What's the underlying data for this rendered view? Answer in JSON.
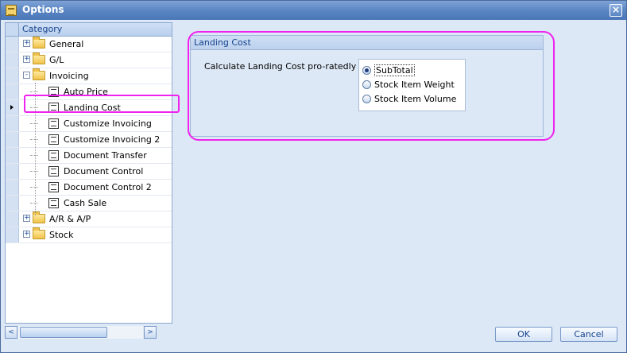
{
  "window": {
    "title": "Options",
    "close_glyph": "×",
    "icon": "options-app-icon"
  },
  "tree": {
    "header": "Category",
    "items": [
      {
        "label": "General",
        "level": 0,
        "type": "folder",
        "expander": "+"
      },
      {
        "label": "G/L",
        "level": 0,
        "type": "folder",
        "expander": "+"
      },
      {
        "label": "Invoicing",
        "level": 0,
        "type": "folder",
        "expander": "-"
      },
      {
        "label": "Auto Price",
        "level": 1,
        "type": "page"
      },
      {
        "label": "Landing Cost",
        "level": 1,
        "type": "page",
        "current": true
      },
      {
        "label": "Customize Invoicing",
        "level": 1,
        "type": "page"
      },
      {
        "label": "Customize Invoicing 2",
        "level": 1,
        "type": "page"
      },
      {
        "label": "Document Transfer",
        "level": 1,
        "type": "page"
      },
      {
        "label": "Document Control",
        "level": 1,
        "type": "page"
      },
      {
        "label": "Document Control 2",
        "level": 1,
        "type": "page"
      },
      {
        "label": "Cash Sale",
        "level": 1,
        "type": "page"
      },
      {
        "label": "A/R & A/P",
        "level": 0,
        "type": "folder",
        "expander": "+"
      },
      {
        "label": "Stock",
        "level": 0,
        "type": "folder",
        "expander": "+"
      }
    ],
    "scroll_left": "<",
    "scroll_right": ">"
  },
  "landing_cost": {
    "title": "Landing Cost",
    "description": "Calculate Landing Cost pro-ratedly by",
    "options": [
      {
        "label": "SubTotal",
        "checked": true
      },
      {
        "label": "Stock Item Weight",
        "checked": false
      },
      {
        "label": "Stock Item Volume",
        "checked": false
      }
    ]
  },
  "buttons": {
    "ok": "OK",
    "cancel": "Cancel"
  },
  "colors": {
    "highlight": "#ef22ef",
    "accent": "#15428b",
    "titlebar": "#5b86c4"
  }
}
